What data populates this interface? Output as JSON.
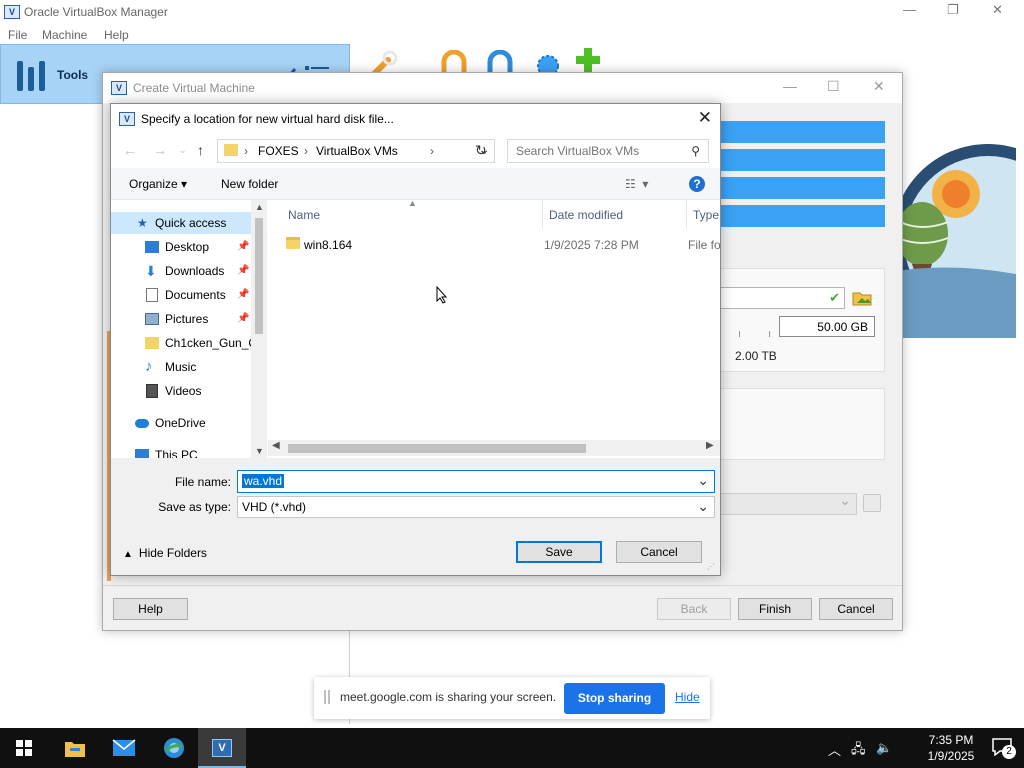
{
  "vbox_manager": {
    "title": "Oracle VirtualBox Manager",
    "menu": [
      "File",
      "Machine",
      "Help"
    ],
    "tools_label": "Tools",
    "minimize_glyph": "—",
    "restore_glyph": "❐",
    "close_glyph": "✕"
  },
  "create_vm": {
    "title": "Create Virtual Machine",
    "disk_size": "50.00 GB",
    "max_size_label": "2.00 TB",
    "buttons": {
      "help": "Help",
      "back": "Back",
      "finish": "Finish",
      "cancel": "Cancel"
    }
  },
  "save_dialog": {
    "title": "Specify a location for new virtual hard disk file...",
    "breadcrumb": [
      "FOXES",
      "VirtualBox VMs"
    ],
    "search_placeholder": "Search VirtualBox VMs",
    "toolbar": {
      "organize": "Organize ▾",
      "new_folder": "New folder"
    },
    "nav_items": [
      {
        "label": "Quick access",
        "icon": "star-icon",
        "pinned": false
      },
      {
        "label": "Desktop",
        "icon": "desktop-icon",
        "pinned": true
      },
      {
        "label": "Downloads",
        "icon": "download-icon",
        "pinned": true
      },
      {
        "label": "Documents",
        "icon": "document-icon",
        "pinned": true
      },
      {
        "label": "Pictures",
        "icon": "pictures-icon",
        "pinned": true
      },
      {
        "label": "Ch1cken_Gun_C",
        "icon": "folder-icon",
        "pinned": false
      },
      {
        "label": "Music",
        "icon": "music-icon",
        "pinned": false
      },
      {
        "label": "Videos",
        "icon": "video-icon",
        "pinned": false
      },
      {
        "label": "OneDrive",
        "icon": "cloud-icon",
        "pinned": false
      },
      {
        "label": "This PC",
        "icon": "pc-icon",
        "pinned": false
      }
    ],
    "columns": {
      "name": "Name",
      "date_modified": "Date modified",
      "type": "Type"
    },
    "files": [
      {
        "name": "win8.164",
        "date_modified": "1/9/2025 7:28 PM",
        "type": "File fo"
      }
    ],
    "file_name_label": "File name:",
    "file_name_value": "wa.vhd",
    "save_type_label": "Save as type:",
    "save_type_value": "VHD (*.vhd)",
    "hide_folders": "Hide Folders",
    "save_button": "Save",
    "cancel_button": "Cancel"
  },
  "meet_bar": {
    "message": "meet.google.com is sharing your screen.",
    "stop_label": "Stop sharing",
    "hide_label": "Hide"
  },
  "taskbar": {
    "time": "7:35 PM",
    "date": "1/9/2025",
    "notification_count": "2"
  }
}
